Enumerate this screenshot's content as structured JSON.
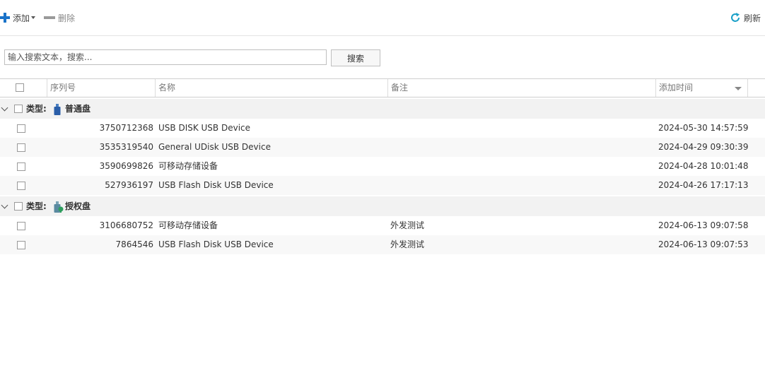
{
  "toolbar": {
    "add_label": "添加",
    "delete_label": "删除",
    "refresh_label": "刷新"
  },
  "search": {
    "placeholder": "输入搜索文本，搜索...",
    "button_label": "搜索"
  },
  "columns": {
    "serial": "序列号",
    "name": "名称",
    "note": "备注",
    "added_time": "添加时间"
  },
  "groups": [
    {
      "type_label": "类型:",
      "name": "普通盘",
      "icon": "usb-drive-icon",
      "rows": [
        {
          "serial": "3750712368",
          "name": "USB DISK USB Device",
          "note": "",
          "time": "2024-05-30 14:57:59"
        },
        {
          "serial": "3535319540",
          "name": "General UDisk USB Device",
          "note": "",
          "time": "2024-04-29 09:30:39"
        },
        {
          "serial": "3590699826",
          "name": "可移动存储设备",
          "note": "",
          "time": "2024-04-28 10:01:48"
        },
        {
          "serial": "527936197",
          "name": "USB Flash Disk USB Device",
          "note": "",
          "time": "2024-04-26 17:17:13"
        }
      ]
    },
    {
      "type_label": "类型:",
      "name": "授权盘",
      "icon": "authorized-usb-icon",
      "rows": [
        {
          "serial": "3106680752",
          "name": "可移动存储设备",
          "note": "外发测试",
          "time": "2024-06-13 09:07:58"
        },
        {
          "serial": "7864546",
          "name": "USB Flash Disk USB Device",
          "note": "外发测试",
          "time": "2024-06-13 09:07:53"
        }
      ]
    }
  ],
  "colors": {
    "accent": "#1a73c9",
    "refresh": "#1aa0c8",
    "group_bg": "#f2f2f2"
  }
}
